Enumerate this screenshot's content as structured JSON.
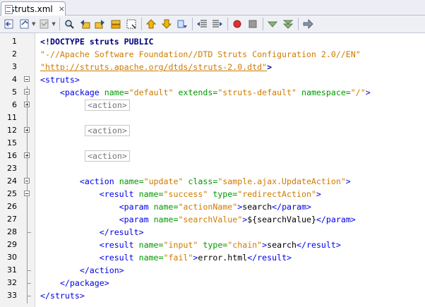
{
  "tab": {
    "title": "struts.xml",
    "close": "×"
  },
  "toolbar": {
    "icons": [
      "last-edit-icon",
      "back-icon",
      "forward-icon",
      "find-icon",
      "find-previous-icon",
      "find-next-icon",
      "find-selection-icon",
      "toggle-highlight-icon",
      "toggle-bookmark-icon",
      "previous-bookmark-icon",
      "next-bookmark-icon",
      "shift-left-icon",
      "shift-right-icon",
      "start-macro-icon",
      "stop-macro-icon",
      "check-xml-icon",
      "validate-xml-icon",
      "xsl-transform-icon"
    ]
  },
  "editor": {
    "lines": [
      {
        "num": "1",
        "text": "<!DOCTYPE struts PUBLIC"
      },
      {
        "num": "2",
        "text": "\"-//Apache Software Foundation//DTD Struts Configuration 2.0//EN\""
      },
      {
        "num": "3",
        "text_link": "\"http://struts.apache.org/dtds/struts-2.0.dtd\"",
        "text_tail": ">"
      },
      {
        "num": "4",
        "text": "<struts>"
      },
      {
        "num": "5",
        "text": "    <package name=\"default\" extends=\"struts-default\" namespace=\"/\">"
      },
      {
        "num": "6",
        "text": "<action>"
      },
      {
        "num": "11",
        "text": ""
      },
      {
        "num": "12",
        "text": "<action>"
      },
      {
        "num": "15",
        "text": ""
      },
      {
        "num": "16",
        "text": "<action>"
      },
      {
        "num": "23",
        "text": ""
      },
      {
        "num": "24",
        "text": "        <action name=\"update\" class=\"sample.ajax.UpdateAction\">"
      },
      {
        "num": "25",
        "text": "            <result name=\"success\" type=\"redirectAction\">"
      },
      {
        "num": "26",
        "text": "                <param name=\"actionName\">search</param>"
      },
      {
        "num": "27",
        "text": "                <param name=\"searchValue\">${searchValue}</param>"
      },
      {
        "num": "28",
        "text": "            </result>"
      },
      {
        "num": "29",
        "text": "            <result name=\"input\" type=\"chain\">search</result>"
      },
      {
        "num": "30",
        "text": "            <result name=\"fail\">error.html</result>"
      },
      {
        "num": "31",
        "text": "        </action>"
      },
      {
        "num": "32",
        "text": "    </package>"
      },
      {
        "num": "33",
        "text": "</struts>"
      }
    ]
  },
  "colors": {
    "keyword": "#000080",
    "tag": "#0000e6",
    "attribute": "#009900",
    "value": "#ce7b00",
    "gutter": "#f2f2f2"
  }
}
